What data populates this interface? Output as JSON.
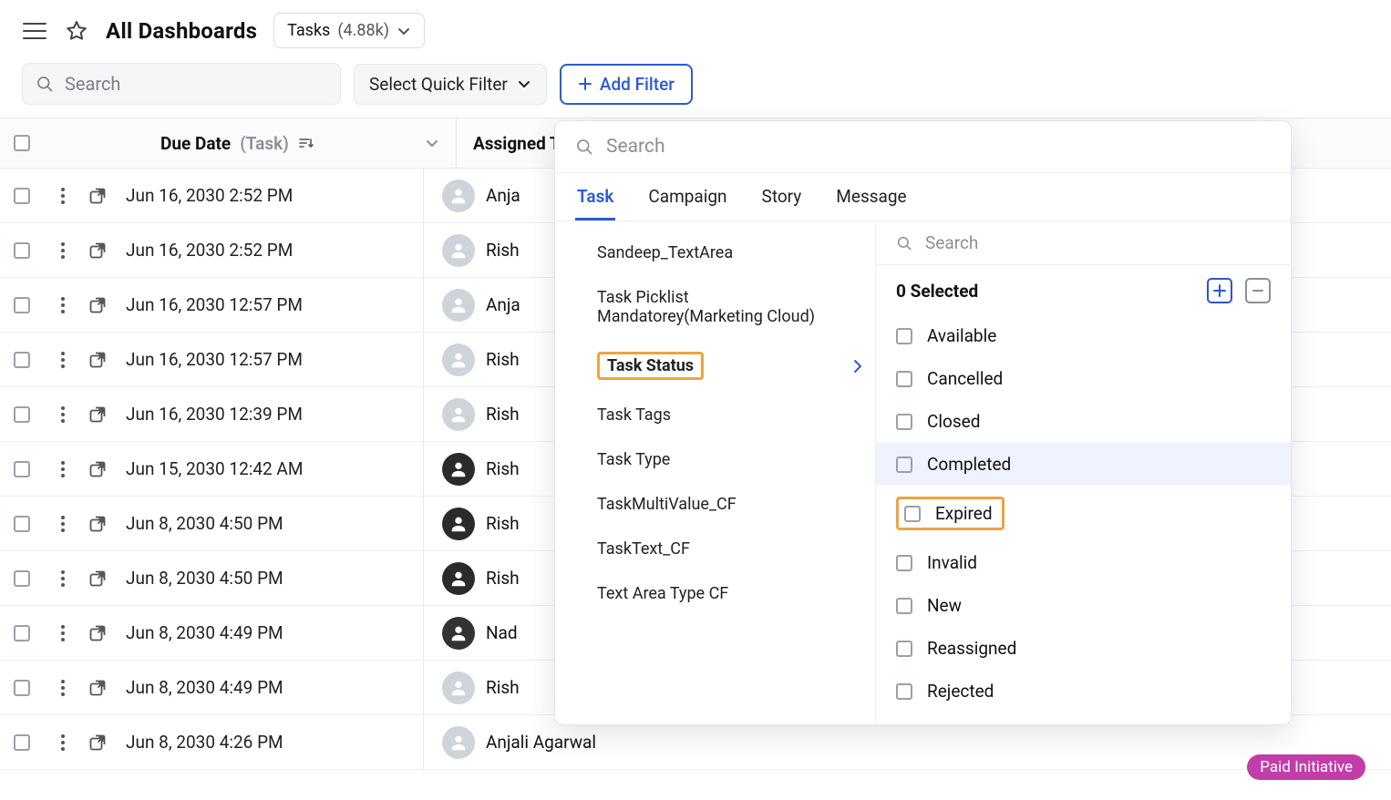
{
  "header": {
    "title": "All Dashboards",
    "selector_label": "Tasks",
    "selector_count": "(4.88k)"
  },
  "filters": {
    "search_placeholder": "Search",
    "quick_filter_label": "Select Quick Filter",
    "add_filter_label": "Add Filter"
  },
  "table": {
    "header": {
      "due_label": "Due Date",
      "due_sub": "(Task)",
      "assigned_label": "Assigned To"
    },
    "rows": [
      {
        "due": "Jun 16, 2030 2:52 PM",
        "name": "Anja",
        "avatar": "default"
      },
      {
        "due": "Jun 16, 2030 2:52 PM",
        "name": "Rish",
        "avatar": "default"
      },
      {
        "due": "Jun 16, 2030 12:57 PM",
        "name": "Anja",
        "avatar": "default"
      },
      {
        "due": "Jun 16, 2030 12:57 PM",
        "name": "Rish",
        "avatar": "default"
      },
      {
        "due": "Jun 16, 2030 12:39 PM",
        "name": "Rish",
        "avatar": "default"
      },
      {
        "due": "Jun 15, 2030 12:42 AM",
        "name": "Rish",
        "avatar": "dark"
      },
      {
        "due": "Jun 8, 2030 4:50 PM",
        "name": "Rish",
        "avatar": "dark"
      },
      {
        "due": "Jun 8, 2030 4:50 PM",
        "name": "Rish",
        "avatar": "dark"
      },
      {
        "due": "Jun 8, 2030 4:49 PM",
        "name": "Nad",
        "avatar": "bike"
      },
      {
        "due": "Jun 8, 2030 4:49 PM",
        "name": "Rish",
        "avatar": "default"
      },
      {
        "due": "Jun 8, 2030 4:26 PM",
        "name": "Anjali Agarwal",
        "avatar": "default"
      }
    ]
  },
  "paid_tag": "Paid Initiative",
  "filter_panel": {
    "search_placeholder": "Search",
    "tabs": [
      "Task",
      "Campaign",
      "Story",
      "Message"
    ],
    "active_tab": 0,
    "left_items": [
      {
        "label": "Sandeep_TextArea"
      },
      {
        "label": "Task Picklist Mandatorey(Marketing Cloud)"
      },
      {
        "label": "Task Status",
        "selected": true,
        "highlighted": true
      },
      {
        "label": "Task Tags"
      },
      {
        "label": "Task Type"
      },
      {
        "label": "TaskMultiValue_CF"
      },
      {
        "label": "TaskText_CF"
      },
      {
        "label": "Text Area Type CF"
      }
    ],
    "right": {
      "search_placeholder": "Search",
      "selected_text": "0 Selected",
      "options": [
        {
          "label": "Available"
        },
        {
          "label": "Cancelled"
        },
        {
          "label": "Closed"
        },
        {
          "label": "Completed",
          "hover": true
        },
        {
          "label": "Expired",
          "highlighted": true
        },
        {
          "label": "Invalid"
        },
        {
          "label": "New"
        },
        {
          "label": "Reassigned"
        },
        {
          "label": "Rejected"
        }
      ]
    }
  }
}
